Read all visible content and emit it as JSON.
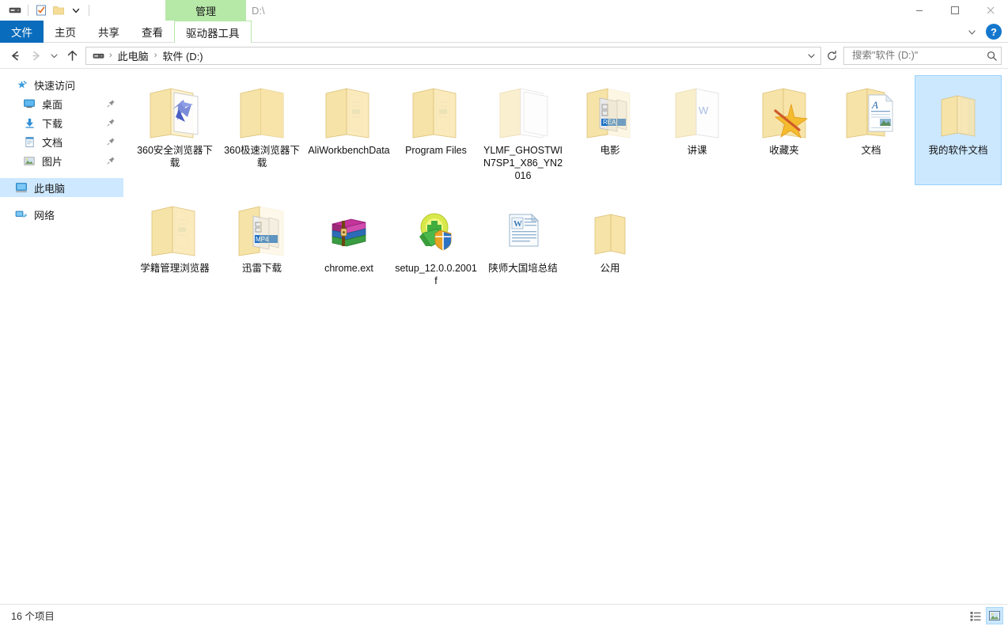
{
  "window": {
    "drive_label": "D:\\",
    "contextual_group": "管理",
    "controls": {
      "minimize": "minimize-icon",
      "maximize": "maximize-icon",
      "close": "close-icon",
      "ribbon_toggle": "chevron-down-icon",
      "help": "?"
    },
    "quick_access": [
      {
        "name": "drive-icon",
        "label": "属性"
      },
      {
        "name": "properties-icon",
        "label": "属性"
      },
      {
        "name": "new-folder-icon",
        "label": "新建文件夹"
      },
      {
        "name": "chevron-down-icon",
        "label": "自定义快速访问工具栏"
      }
    ]
  },
  "ribbon": {
    "tabs": [
      {
        "id": "file",
        "label": "文件"
      },
      {
        "id": "home",
        "label": "主页"
      },
      {
        "id": "share",
        "label": "共享"
      },
      {
        "id": "view",
        "label": "查看"
      },
      {
        "id": "drive-tools",
        "label": "驱动器工具"
      }
    ]
  },
  "address": {
    "back": "back-arrow-icon",
    "forward": "forward-arrow-icon",
    "recent": "chevron-down-icon",
    "up": "up-arrow-icon",
    "breadcrumbs": [
      {
        "icon": "drive-icon",
        "label": ""
      },
      {
        "icon": "",
        "label": "此电脑"
      },
      {
        "icon": "",
        "label": "软件 (D:)"
      }
    ],
    "dropdown": "chevron-down-icon",
    "refresh": "refresh-icon",
    "separator": "›"
  },
  "search": {
    "placeholder": "搜索\"软件 (D:)\"",
    "value": "",
    "icon": "search-icon"
  },
  "sidebar": {
    "items": [
      {
        "label": "快速访问",
        "icon": "star-pin-icon",
        "indent": false,
        "pinned": false,
        "selected": false
      },
      {
        "label": "桌面",
        "icon": "desktop-icon",
        "indent": true,
        "pinned": true,
        "selected": false
      },
      {
        "label": "下载",
        "icon": "downloads-icon",
        "indent": true,
        "pinned": true,
        "selected": false
      },
      {
        "label": "文档",
        "icon": "documents-icon",
        "indent": true,
        "pinned": true,
        "selected": false
      },
      {
        "label": "图片",
        "icon": "pictures-icon",
        "indent": true,
        "pinned": true,
        "selected": false
      },
      {
        "label": "此电脑",
        "icon": "this-pc-icon",
        "indent": false,
        "pinned": false,
        "selected": true
      },
      {
        "label": "网络",
        "icon": "network-icon",
        "indent": false,
        "pinned": false,
        "selected": false
      }
    ]
  },
  "files": [
    {
      "name": "360安全浏览器下载",
      "type": "folder",
      "variant": "browser-arrow",
      "selected": false
    },
    {
      "name": "360极速浏览器下载",
      "type": "folder",
      "variant": "plain",
      "selected": false
    },
    {
      "name": "AliWorkbenchData",
      "type": "folder",
      "variant": "docs",
      "selected": false
    },
    {
      "name": "Program Files",
      "type": "folder",
      "variant": "docs",
      "selected": false
    },
    {
      "name": "YLMF_GHOSTWIN7SP1_X86_YN2016",
      "type": "folder",
      "variant": "hidden",
      "selected": false
    },
    {
      "name": "电影",
      "type": "folder",
      "variant": "media",
      "selected": false
    },
    {
      "name": "讲课",
      "type": "folder",
      "variant": "hidden-doc",
      "selected": false
    },
    {
      "name": "收藏夹",
      "type": "folder",
      "variant": "favorites",
      "selected": false
    },
    {
      "name": "文档",
      "type": "folder",
      "variant": "document",
      "selected": false
    },
    {
      "name": "我的软件文档",
      "type": "folder",
      "variant": "papers",
      "selected": true
    },
    {
      "name": "学籍管理浏览器",
      "type": "folder",
      "variant": "docs",
      "selected": false
    },
    {
      "name": "迅雷下载",
      "type": "folder",
      "variant": "mp4",
      "selected": false
    },
    {
      "name": "chrome.ext",
      "type": "file",
      "variant": "winrar",
      "selected": false
    },
    {
      "name": "setup_12.0.0.2001f",
      "type": "file",
      "variant": "installer-shield",
      "selected": false
    },
    {
      "name": "陕师大国培总结",
      "type": "file",
      "variant": "word-doc",
      "selected": false
    },
    {
      "name": "公用",
      "type": "folder",
      "variant": "plain-flat",
      "selected": false
    }
  ],
  "status": {
    "item_count": "16 个项目",
    "views": [
      {
        "name": "details-view-button",
        "label": "详细信息",
        "active": false
      },
      {
        "name": "large-icons-view-button",
        "label": "大图标",
        "active": true
      }
    ]
  },
  "colors": {
    "file_tab_blue": "#0a6cbc",
    "contextual_green": "#b6e8a8",
    "selection_blue": "#cce8ff",
    "selection_border": "#99d1ff",
    "help_blue": "#1477cd",
    "folder_yellow": "#f9df9a"
  }
}
